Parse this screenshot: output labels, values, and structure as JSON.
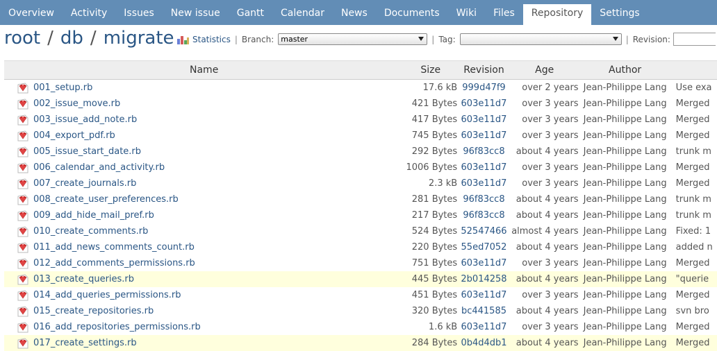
{
  "nav": {
    "tabs": [
      {
        "label": "Overview",
        "selected": false
      },
      {
        "label": "Activity",
        "selected": false
      },
      {
        "label": "Issues",
        "selected": false
      },
      {
        "label": "New issue",
        "selected": false
      },
      {
        "label": "Gantt",
        "selected": false
      },
      {
        "label": "Calendar",
        "selected": false
      },
      {
        "label": "News",
        "selected": false
      },
      {
        "label": "Documents",
        "selected": false
      },
      {
        "label": "Wiki",
        "selected": false
      },
      {
        "label": "Files",
        "selected": false
      },
      {
        "label": "Repository",
        "selected": true
      },
      {
        "label": "Settings",
        "selected": false
      }
    ]
  },
  "breadcrumb": {
    "segments": [
      "root",
      "db",
      "migrate"
    ],
    "separator": "/"
  },
  "toolbar": {
    "statistics_label": "Statistics",
    "pipe": "|",
    "branch_label": "Branch:",
    "branch_value": "master",
    "tag_label": "Tag:",
    "tag_value": "",
    "revision_label": "Revision:"
  },
  "table": {
    "headers": {
      "name": "Name",
      "size": "Size",
      "revision": "Revision",
      "age": "Age",
      "author": "Author"
    },
    "rows": [
      {
        "name": "001_setup.rb",
        "size": "17.6 kB",
        "revision": "999d47f9",
        "age": "over 2 years",
        "author": "Jean-Philippe Lang",
        "comment": "Use exa",
        "highlight": false
      },
      {
        "name": "002_issue_move.rb",
        "size": "421 Bytes",
        "revision": "603e11d7",
        "age": "over 3 years",
        "author": "Jean-Philippe Lang",
        "comment": "Merged",
        "highlight": false
      },
      {
        "name": "003_issue_add_note.rb",
        "size": "417 Bytes",
        "revision": "603e11d7",
        "age": "over 3 years",
        "author": "Jean-Philippe Lang",
        "comment": "Merged",
        "highlight": false
      },
      {
        "name": "004_export_pdf.rb",
        "size": "745 Bytes",
        "revision": "603e11d7",
        "age": "over 3 years",
        "author": "Jean-Philippe Lang",
        "comment": "Merged",
        "highlight": false
      },
      {
        "name": "005_issue_start_date.rb",
        "size": "292 Bytes",
        "revision": "96f83cc8",
        "age": "about 4 years",
        "author": "Jean-Philippe Lang",
        "comment": "trunk m",
        "highlight": false
      },
      {
        "name": "006_calendar_and_activity.rb",
        "size": "1006 Bytes",
        "revision": "603e11d7",
        "age": "over 3 years",
        "author": "Jean-Philippe Lang",
        "comment": "Merged",
        "highlight": false
      },
      {
        "name": "007_create_journals.rb",
        "size": "2.3 kB",
        "revision": "603e11d7",
        "age": "over 3 years",
        "author": "Jean-Philippe Lang",
        "comment": "Merged",
        "highlight": false
      },
      {
        "name": "008_create_user_preferences.rb",
        "size": "281 Bytes",
        "revision": "96f83cc8",
        "age": "about 4 years",
        "author": "Jean-Philippe Lang",
        "comment": "trunk m",
        "highlight": false
      },
      {
        "name": "009_add_hide_mail_pref.rb",
        "size": "217 Bytes",
        "revision": "96f83cc8",
        "age": "about 4 years",
        "author": "Jean-Philippe Lang",
        "comment": "trunk m",
        "highlight": false
      },
      {
        "name": "010_create_comments.rb",
        "size": "524 Bytes",
        "revision": "52547466",
        "age": "almost 4 years",
        "author": "Jean-Philippe Lang",
        "comment": "Fixed: 1",
        "highlight": false
      },
      {
        "name": "011_add_news_comments_count.rb",
        "size": "220 Bytes",
        "revision": "55ed7052",
        "age": "about 4 years",
        "author": "Jean-Philippe Lang",
        "comment": "added n",
        "highlight": false
      },
      {
        "name": "012_add_comments_permissions.rb",
        "size": "751 Bytes",
        "revision": "603e11d7",
        "age": "over 3 years",
        "author": "Jean-Philippe Lang",
        "comment": "Merged",
        "highlight": false
      },
      {
        "name": "013_create_queries.rb",
        "size": "445 Bytes",
        "revision": "2b014258",
        "age": "about 4 years",
        "author": "Jean-Philippe Lang",
        "comment": "\"querie",
        "highlight": true
      },
      {
        "name": "014_add_queries_permissions.rb",
        "size": "451 Bytes",
        "revision": "603e11d7",
        "age": "over 3 years",
        "author": "Jean-Philippe Lang",
        "comment": "Merged",
        "highlight": false
      },
      {
        "name": "015_create_repositories.rb",
        "size": "320 Bytes",
        "revision": "bc441585",
        "age": "about 4 years",
        "author": "Jean-Philippe Lang",
        "comment": "svn bro",
        "highlight": false
      },
      {
        "name": "016_add_repositories_permissions.rb",
        "size": "1.6 kB",
        "revision": "603e11d7",
        "age": "over 3 years",
        "author": "Jean-Philippe Lang",
        "comment": "Merged",
        "highlight": false
      },
      {
        "name": "017_create_settings.rb",
        "size": "284 Bytes",
        "revision": "0b4d4db1",
        "age": "about 4 years",
        "author": "Jean-Philippe Lang",
        "comment": "Merged",
        "highlight": true
      }
    ]
  },
  "colors": {
    "nav_bg": "#628db6",
    "link": "#2a5685",
    "highlight_row": "#ffffdd",
    "ruby_red": "#cc2222"
  },
  "icons": {
    "file": "ruby-icon",
    "statistics": "bar-chart-icon"
  }
}
